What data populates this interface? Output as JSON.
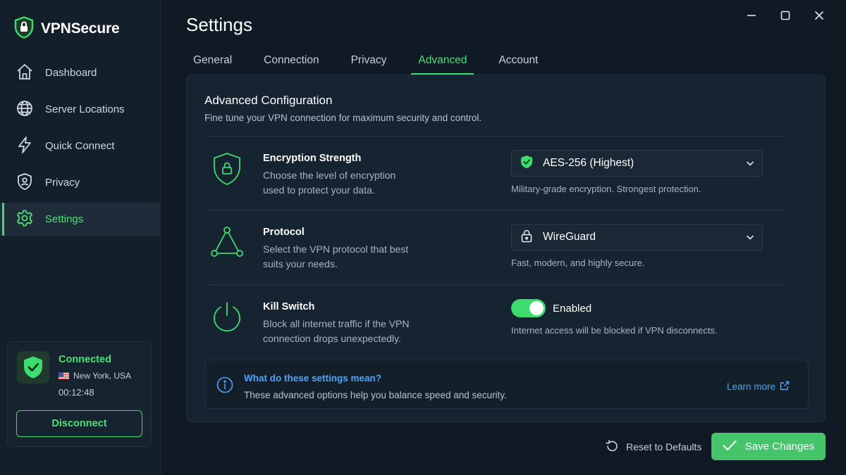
{
  "app": {
    "name": "VPNSecure",
    "accent": "#3ddc6e"
  },
  "sidebar": {
    "items": [
      {
        "label": "Dashboard",
        "icon": "home-icon"
      },
      {
        "label": "Server Locations",
        "icon": "globe-icon"
      },
      {
        "label": "Quick Connect",
        "icon": "lightning-icon"
      },
      {
        "label": "Privacy",
        "icon": "shield-user-icon"
      },
      {
        "label": "Settings",
        "icon": "gear-icon",
        "active": true
      }
    ]
  },
  "status": {
    "title": "Connected",
    "location": "New York, USA",
    "timer": "00:12:48",
    "disconnect_label": "Disconnect"
  },
  "header": {
    "title": "Settings"
  },
  "tabs": [
    {
      "label": "General"
    },
    {
      "label": "Connection"
    },
    {
      "label": "Privacy"
    },
    {
      "label": "Advanced",
      "active": true
    },
    {
      "label": "Account"
    }
  ],
  "panel": {
    "title": "Advanced Configuration",
    "subtitle": "Fine tune your VPN connection for maximum security and control.",
    "encryption": {
      "title": "Encryption Strength",
      "description": "Choose the level of encryption used to protect your data.",
      "selected": "AES-256 (Highest)",
      "hint": "Military-grade encryption. Strongest protection."
    },
    "protocol": {
      "title": "Protocol",
      "description": "Select the VPN protocol that best suits your needs.",
      "selected": "WireGuard",
      "hint": "Fast, modern, and highly secure."
    },
    "kill_switch": {
      "title": "Kill Switch",
      "description": "Block all internet traffic if the VPN connection drops unexpectedly.",
      "state_label": "Enabled",
      "hint": "Internet access will be blocked if VPN disconnects."
    },
    "info": {
      "title": "What do these settings mean?",
      "description": "These advanced options help you balance speed and security.",
      "link": "Learn more"
    }
  },
  "footer": {
    "reset_label": "Reset to Defaults",
    "save_label": "Save Changes"
  }
}
